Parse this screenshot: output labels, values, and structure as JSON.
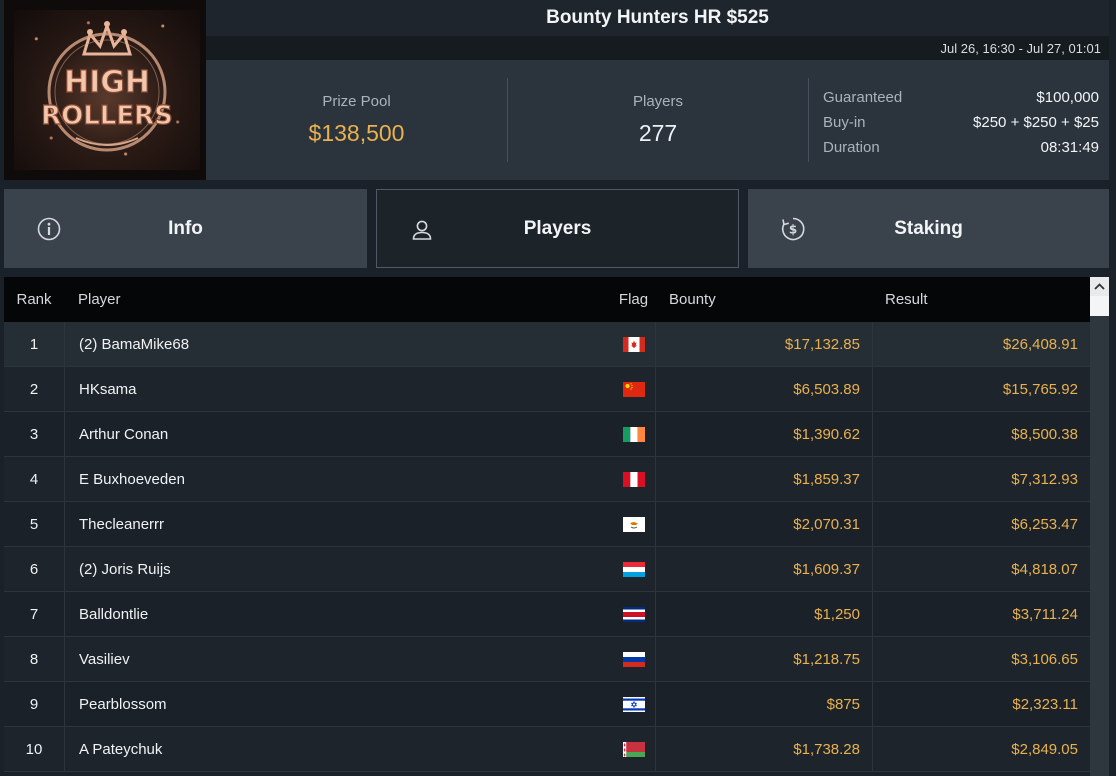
{
  "logo": {
    "line1": "HIGH",
    "line2": "ROLLERS",
    "icon": "high-rollers-crown-logo"
  },
  "header": {
    "title": "Bounty Hunters HR $525",
    "dates": "Jul 26, 16:30 - Jul 27, 01:01"
  },
  "stats": {
    "prize_pool_label": "Prize Pool",
    "prize_pool_value": "$138,500",
    "players_label": "Players",
    "players_value": "277",
    "guaranteed_label": "Guaranteed",
    "guaranteed_value": "$100,000",
    "buyin_label": "Buy-in",
    "buyin_value": "$250 + $250 + $25",
    "duration_label": "Duration",
    "duration_value": "08:31:49"
  },
  "tabs": [
    {
      "label": "Info",
      "icon": "info-icon",
      "active": false
    },
    {
      "label": "Players",
      "icon": "user-icon",
      "active": true
    },
    {
      "label": "Staking",
      "icon": "staking-icon",
      "active": false
    }
  ],
  "table": {
    "headers": {
      "rank": "Rank",
      "player": "Player",
      "flag": "Flag",
      "bounty": "Bounty",
      "result": "Result"
    },
    "rows": [
      {
        "rank": "1",
        "player": "(2) BamaMike68",
        "flag": "canada",
        "bounty": "$17,132.85",
        "result": "$26,408.91"
      },
      {
        "rank": "2",
        "player": "HKsama",
        "flag": "china",
        "bounty": "$6,503.89",
        "result": "$15,765.92"
      },
      {
        "rank": "3",
        "player": "Arthur Conan",
        "flag": "ireland",
        "bounty": "$1,390.62",
        "result": "$8,500.38"
      },
      {
        "rank": "4",
        "player": "E Buxhoeveden",
        "flag": "peru",
        "bounty": "$1,859.37",
        "result": "$7,312.93"
      },
      {
        "rank": "5",
        "player": "Thecleanerrr",
        "flag": "cyprus",
        "bounty": "$2,070.31",
        "result": "$6,253.47"
      },
      {
        "rank": "6",
        "player": "(2) Joris Ruijs",
        "flag": "luxembourg",
        "bounty": "$1,609.37",
        "result": "$4,818.07"
      },
      {
        "rank": "7",
        "player": "Balldontlie",
        "flag": "costa-rica",
        "bounty": "$1,250",
        "result": "$3,711.24"
      },
      {
        "rank": "8",
        "player": "Vasiliev",
        "flag": "russia",
        "bounty": "$1,218.75",
        "result": "$3,106.65"
      },
      {
        "rank": "9",
        "player": "Pearblossom",
        "flag": "israel",
        "bounty": "$875",
        "result": "$2,323.11"
      },
      {
        "rank": "10",
        "player": "A Pateychuk",
        "flag": "belarus",
        "bounty": "$1,738.28",
        "result": "$2,849.05"
      }
    ]
  },
  "colors": {
    "gold": "#e9b14f",
    "background": "#1b2128",
    "panel": "#2b343d",
    "tab": "#3a434c"
  }
}
